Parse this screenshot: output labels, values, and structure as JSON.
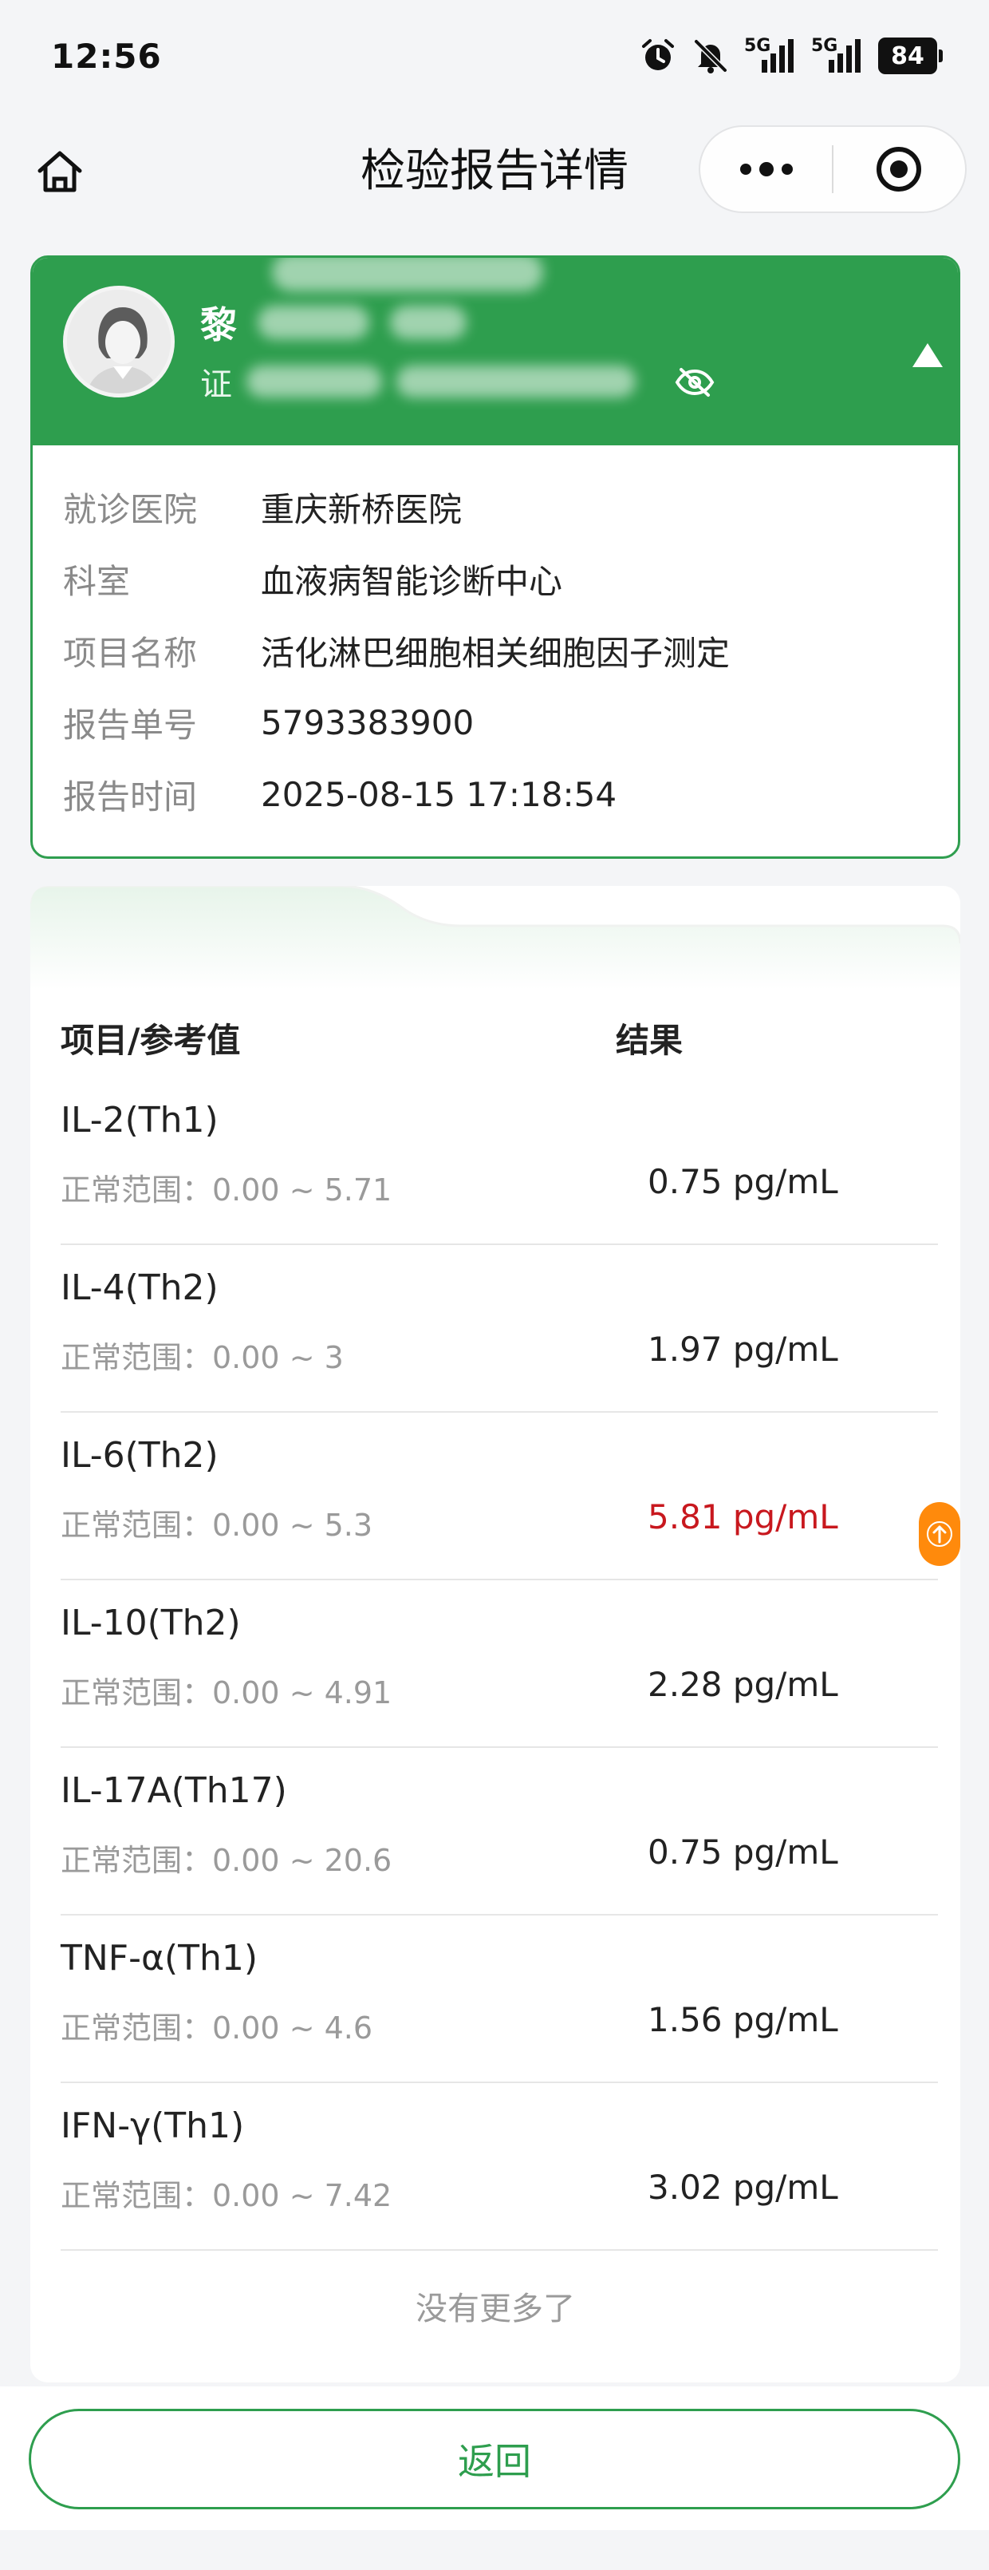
{
  "status_bar": {
    "time": "12:56",
    "network_label_1": "5G",
    "network_label_2": "5G",
    "battery": "84",
    "icons": [
      "alarm-icon",
      "bell-off-icon",
      "signal-icon",
      "signal-icon",
      "battery-icon"
    ]
  },
  "nav": {
    "title": "检验报告详情",
    "home_icon": "home-icon",
    "more_icon": "more-dots-icon",
    "close_icon": "target-circle-icon"
  },
  "patient": {
    "name": "黎",
    "id_label": "证",
    "eye_icon": "eye-off-icon",
    "collapse_icon": "triangle-up-icon",
    "info": [
      {
        "label": "就诊医院",
        "value": "重庆新桥医院"
      },
      {
        "label": "科室",
        "value": "血液病智能诊断中心"
      },
      {
        "label": "项目名称",
        "value": "活化淋巴细胞相关细胞因子测定"
      },
      {
        "label": "报告单号",
        "value": "5793383900"
      },
      {
        "label": "报告时间",
        "value": "2025-08-15 17:18:54"
      }
    ]
  },
  "results": {
    "header_item": "项目/参考值",
    "header_result": "结果",
    "items": [
      {
        "name": "IL-2(Th1)",
        "range": "正常范围：0.00 ~ 5.71",
        "value": "0.75 pg/mL",
        "abnormal": false
      },
      {
        "name": "IL-4(Th2)",
        "range": "正常范围：0.00 ~ 3",
        "value": "1.97 pg/mL",
        "abnormal": false
      },
      {
        "name": "IL-6(Th2)",
        "range": "正常范围：0.00 ~ 5.3",
        "value": "5.81 pg/mL",
        "abnormal": true
      },
      {
        "name": "IL-10(Th2)",
        "range": "正常范围：0.00 ~ 4.91",
        "value": "2.28 pg/mL",
        "abnormal": false
      },
      {
        "name": "IL-17A(Th17)",
        "range": "正常范围：0.00 ~ 20.6",
        "value": "0.75 pg/mL",
        "abnormal": false
      },
      {
        "name": "TNF-α(Th1)",
        "range": "正常范围：0.00 ~ 4.6",
        "value": "1.56 pg/mL",
        "abnormal": false
      },
      {
        "name": "IFN-γ(Th1)",
        "range": "正常范围：0.00 ~ 7.42",
        "value": "3.02 pg/mL",
        "abnormal": false
      }
    ],
    "abnormal_icon": "arrow-up-icon",
    "abnormal_color": "#c8181e",
    "flag_color": "#ff8a0c",
    "footer": "没有更多了"
  },
  "back_button": "返回",
  "theme": {
    "primary": "#2e9e4e",
    "background": "#f4f5f7"
  }
}
